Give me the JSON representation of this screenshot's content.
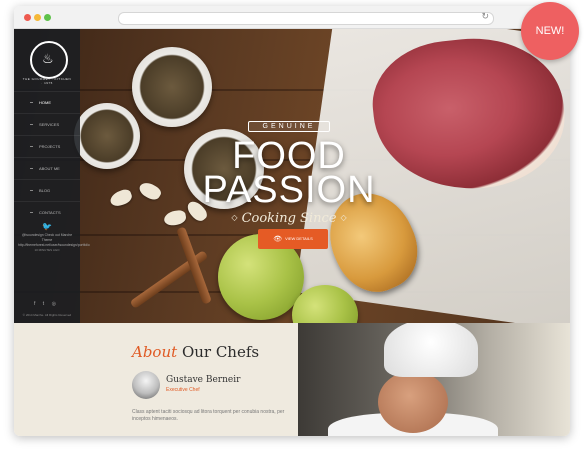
{
  "badge": {
    "label": "NEW!"
  },
  "sidebar": {
    "logo_text": "THE GOURMET · KITCHEN · 1975",
    "nav": [
      "HOME",
      "SERVICES",
      "PROJECTS",
      "ABOUT ME",
      "BLOG",
      "CONTACTS"
    ],
    "tweet": {
      "handle": "@tsoundesign",
      "text": "Check out Marche Theme",
      "link": "http://themeforest.net/user/tsoundesign/portfolio",
      "time": "10 MINUTES AGO"
    },
    "copyright": "© 2014 Marche. All Rights Reserved"
  },
  "hero": {
    "ribbon": "GENUINE",
    "title": "FOOD PASSION",
    "subtitle": "Cooking Since",
    "cta": "VIEW DETAILS"
  },
  "about": {
    "title_accent": "About",
    "title_rest": "Our Chefs",
    "chef_name": "Gustave Berneir",
    "chef_role": "Executive Chef",
    "text": "Class aptent taciti sociosqu ad litora torquent per conubia nostra, per inceptos himenaeos."
  }
}
